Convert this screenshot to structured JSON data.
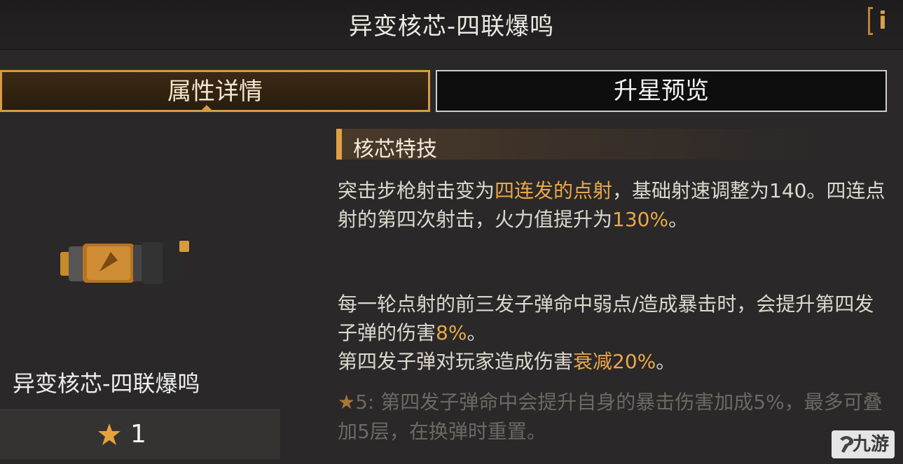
{
  "header": {
    "title": "异变核芯-四联爆鸣",
    "info_icon": "info-icon"
  },
  "tabs": [
    {
      "label": "属性详情",
      "active": true
    },
    {
      "label": "升星预览",
      "active": false
    }
  ],
  "core": {
    "name": "异变核芯-四联爆鸣",
    "star_icon": "star-icon",
    "star_count": "1"
  },
  "skill": {
    "heading": "核芯特技",
    "p1": {
      "a": "突击步枪射击变为",
      "b": "四连发的点射",
      "c": "，基础射速调整为140。四连点射的第四次射击，火力值提升为",
      "d": "130%",
      "e": "。"
    },
    "p2": {
      "a": "每一轮点射的前三发子弹命中弱点/造成暴击时，会提升第四发子弹的伤害",
      "b": "8%",
      "c": "。"
    },
    "p3": {
      "a": "第四发子弹对玩家造成伤害",
      "b": "衰减20%",
      "c": "。"
    },
    "star5": {
      "prefix": "★",
      "text": "5: 第四发子弹命中会提升自身的暴击伤害加成5%，最多可叠加5层，在换弹时重置。"
    }
  },
  "watermark": {
    "text": "九游"
  },
  "colors": {
    "accent": "#e0a045",
    "highlight": "#e9a84b",
    "bg": "#2a2828"
  }
}
